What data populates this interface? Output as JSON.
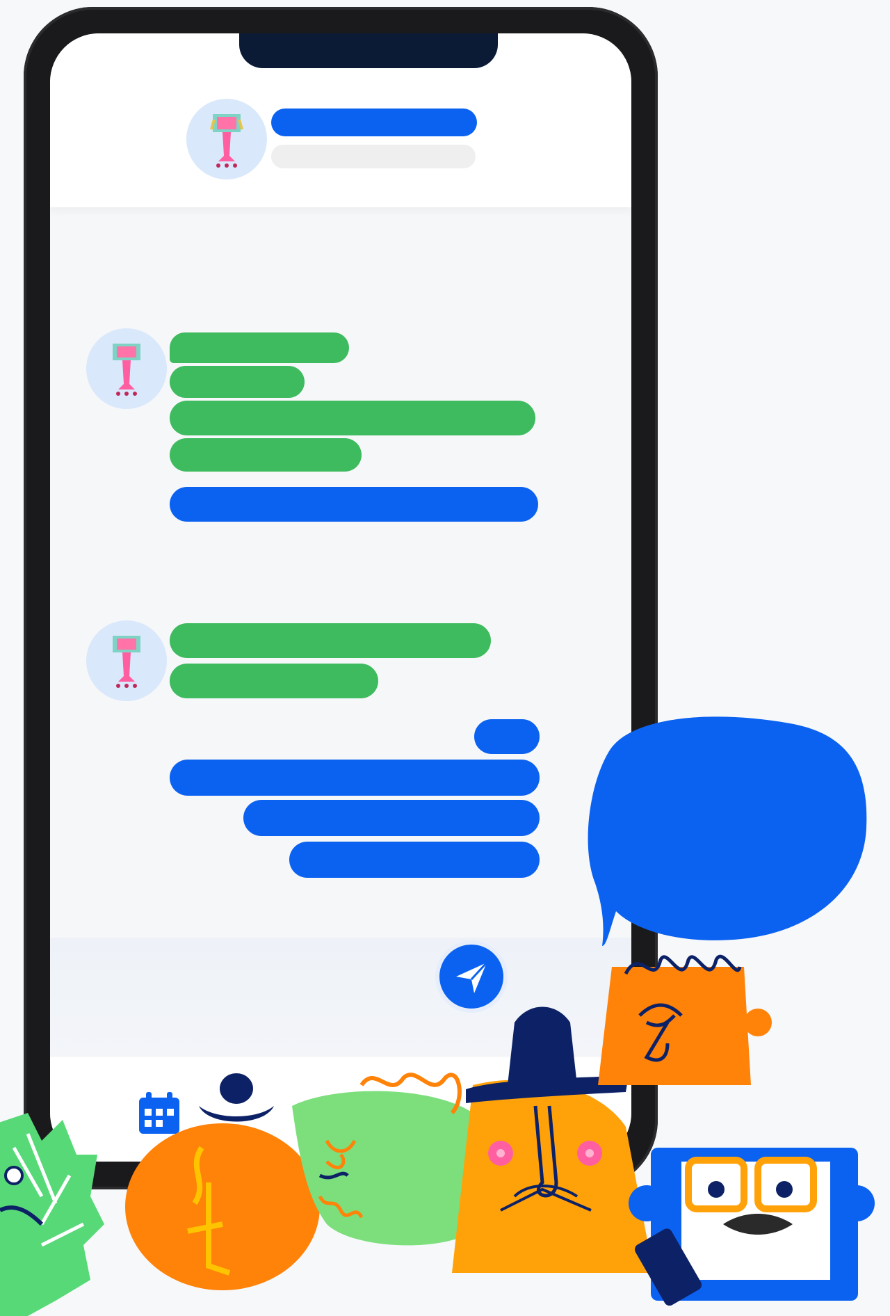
{
  "illustration": {
    "subject": "phone-chat-screen",
    "colors": {
      "blue": "#0b62f0",
      "green": "#3dbb5e",
      "orange": "#ff8209",
      "light_green": "#7cdf7c",
      "navy": "#0d2266",
      "phone_frame": "#1a1a1c"
    },
    "icons": [
      "send-icon",
      "calendar-icon"
    ]
  }
}
